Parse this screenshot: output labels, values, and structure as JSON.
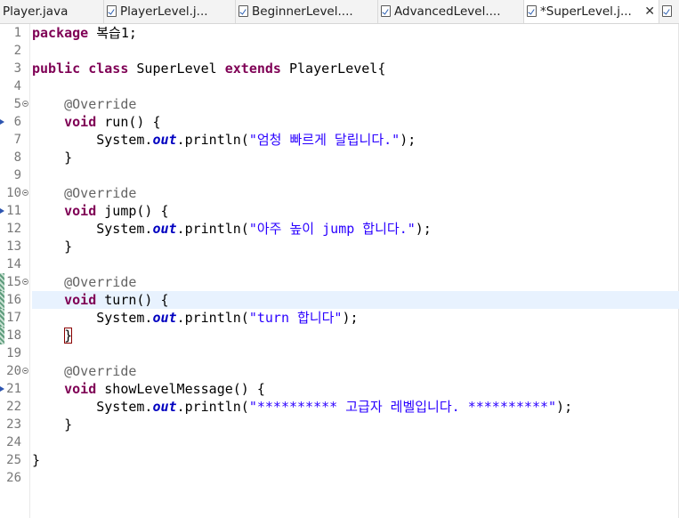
{
  "tabs": [
    {
      "label": "Player.java",
      "active": false
    },
    {
      "label": "PlayerLevel.j...",
      "active": false
    },
    {
      "label": "BeginnerLevel....",
      "active": false
    },
    {
      "label": "AdvancedLevel....",
      "active": false
    },
    {
      "label": "*SuperLevel.j...",
      "active": true
    }
  ],
  "close_symbol": "✕",
  "lines": [
    {
      "n": "1"
    },
    {
      "n": "2"
    },
    {
      "n": "3"
    },
    {
      "n": "4"
    },
    {
      "n": "5"
    },
    {
      "n": "6"
    },
    {
      "n": "7"
    },
    {
      "n": "8"
    },
    {
      "n": "9"
    },
    {
      "n": "10"
    },
    {
      "n": "11"
    },
    {
      "n": "12"
    },
    {
      "n": "13"
    },
    {
      "n": "14"
    },
    {
      "n": "15"
    },
    {
      "n": "16"
    },
    {
      "n": "17"
    },
    {
      "n": "18"
    },
    {
      "n": "19"
    },
    {
      "n": "20"
    },
    {
      "n": "21"
    },
    {
      "n": "22"
    },
    {
      "n": "23"
    },
    {
      "n": "24"
    },
    {
      "n": "25"
    },
    {
      "n": "26"
    }
  ],
  "code": {
    "kw_package": "package",
    "pkg_name": " 복습1;",
    "kw_public": "public",
    "kw_class": "class",
    "class_name": " SuperLevel ",
    "kw_extends": "extends",
    "super_name": " PlayerLevel{",
    "override": "@Override",
    "kw_void": "void",
    "system": "System.",
    "out": "out",
    "println": ".println(",
    "end": ");",
    "close_brace": "}",
    "m1_sig": " run() {",
    "m1_str": "\"엄청 빠르게 달립니다.\"",
    "m2_sig": " jump() {",
    "m2_str": "\"아주 높이 jump 합니다.\"",
    "m3_sig": " turn() {",
    "m3_str": "\"turn 합니다\"",
    "m4_sig": " showLevelMessage() {",
    "m4_str": "\"********** 고급자 레벨입니다. **********\""
  },
  "colors": {
    "keyword": "#7f0055",
    "annotation": "#646464",
    "static_field": "#0000c0",
    "string": "#2a00ff",
    "current_line": "#e8f2fe"
  }
}
